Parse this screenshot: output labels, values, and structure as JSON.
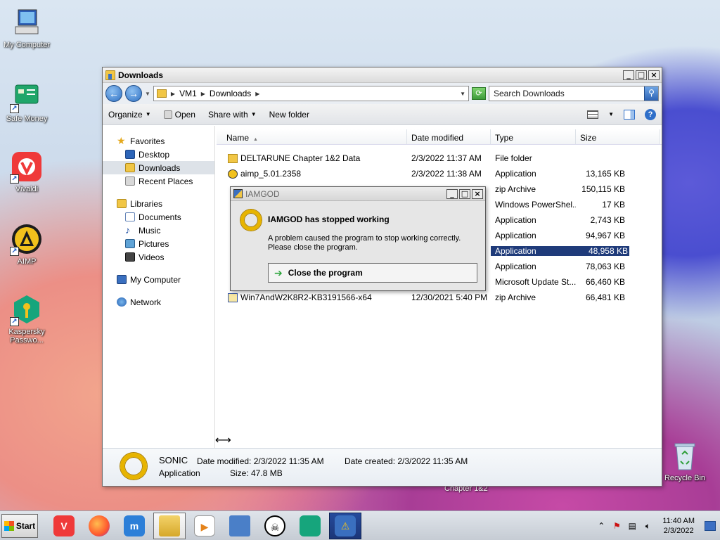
{
  "desktop": {
    "icons": [
      {
        "label": "My Computer",
        "icon": "computer-icon"
      },
      {
        "label": "Safe Money",
        "icon": "safe-money-icon"
      },
      {
        "label": "Vivaldi",
        "icon": "vivaldi-icon"
      },
      {
        "label": "AIMP",
        "icon": "aimp-icon"
      },
      {
        "label": "Kaspersky Passwo...",
        "icon": "kaspersky-password-icon"
      },
      {
        "label": "Recycle Bin",
        "icon": "recycle-bin-icon"
      }
    ],
    "underlay_text": "Chapter 1&2"
  },
  "explorer": {
    "title": "Downloads",
    "address": {
      "crumbs": [
        "VM1",
        "Downloads"
      ]
    },
    "search_placeholder": "Search Downloads",
    "toolbar": {
      "organize": "Organize",
      "open": "Open",
      "share_with": "Share with",
      "new_folder": "New folder"
    },
    "nav": {
      "favorites": "Favorites",
      "desktop": "Desktop",
      "downloads": "Downloads",
      "recent": "Recent Places",
      "libraries": "Libraries",
      "documents": "Documents",
      "music": "Music",
      "pictures": "Pictures",
      "videos": "Videos",
      "computer": "My Computer",
      "network": "Network"
    },
    "columns": {
      "name": "Name",
      "date": "Date modified",
      "type": "Type",
      "size": "Size"
    },
    "rows": [
      {
        "name": "DELTARUNE Chapter 1&2 Data",
        "date": "2/3/2022 11:37 AM",
        "type": "File folder",
        "size": ""
      },
      {
        "name": "aimp_5.01.2358",
        "date": "2/3/2022 11:38 AM",
        "type": "Application",
        "size": "13,165 KB"
      },
      {
        "name": "",
        "date": "",
        "type": "zip Archive",
        "size": "150,115 KB"
      },
      {
        "name": "",
        "date": "",
        "type": "Windows PowerShel...",
        "size": "17 KB"
      },
      {
        "name": "",
        "date": "",
        "type": "Application",
        "size": "2,743 KB"
      },
      {
        "name": "",
        "date": "",
        "type": "Application",
        "size": "94,967 KB"
      },
      {
        "name": "",
        "date": "",
        "type": "Application",
        "size": "48,958 KB"
      },
      {
        "name": "",
        "date": "",
        "type": "Application",
        "size": "78,063 KB"
      },
      {
        "name": "",
        "date": "",
        "type": "Microsoft Update St...",
        "size": "66,460 KB"
      },
      {
        "name": "Win7AndW2K8R2-KB3191566-x64",
        "date": "12/30/2021 5:40 PM",
        "type": "zip Archive",
        "size": "66,481 KB"
      }
    ],
    "details": {
      "name": "SONIC",
      "kind": "Application",
      "date_modified": "Date modified: 2/3/2022 11:35 AM",
      "size": "Size: 47.8 MB",
      "date_created": "Date created: 2/3/2022 11:35 AM"
    }
  },
  "dialog": {
    "title": "IAMGOD",
    "heading": "IAMGOD has stopped working",
    "message_line1": "A problem caused the program to stop working correctly.",
    "message_line2": "Please close the program.",
    "button": "Close the program"
  },
  "taskbar": {
    "start": "Start",
    "apps": [
      "vivaldi",
      "firefox",
      "maxthon",
      "explorer",
      "media-player",
      "control-panel",
      "skull-app",
      "kaspersky",
      "iamgod"
    ],
    "clock": {
      "time": "11:40 AM",
      "date": "2/3/2022"
    }
  }
}
